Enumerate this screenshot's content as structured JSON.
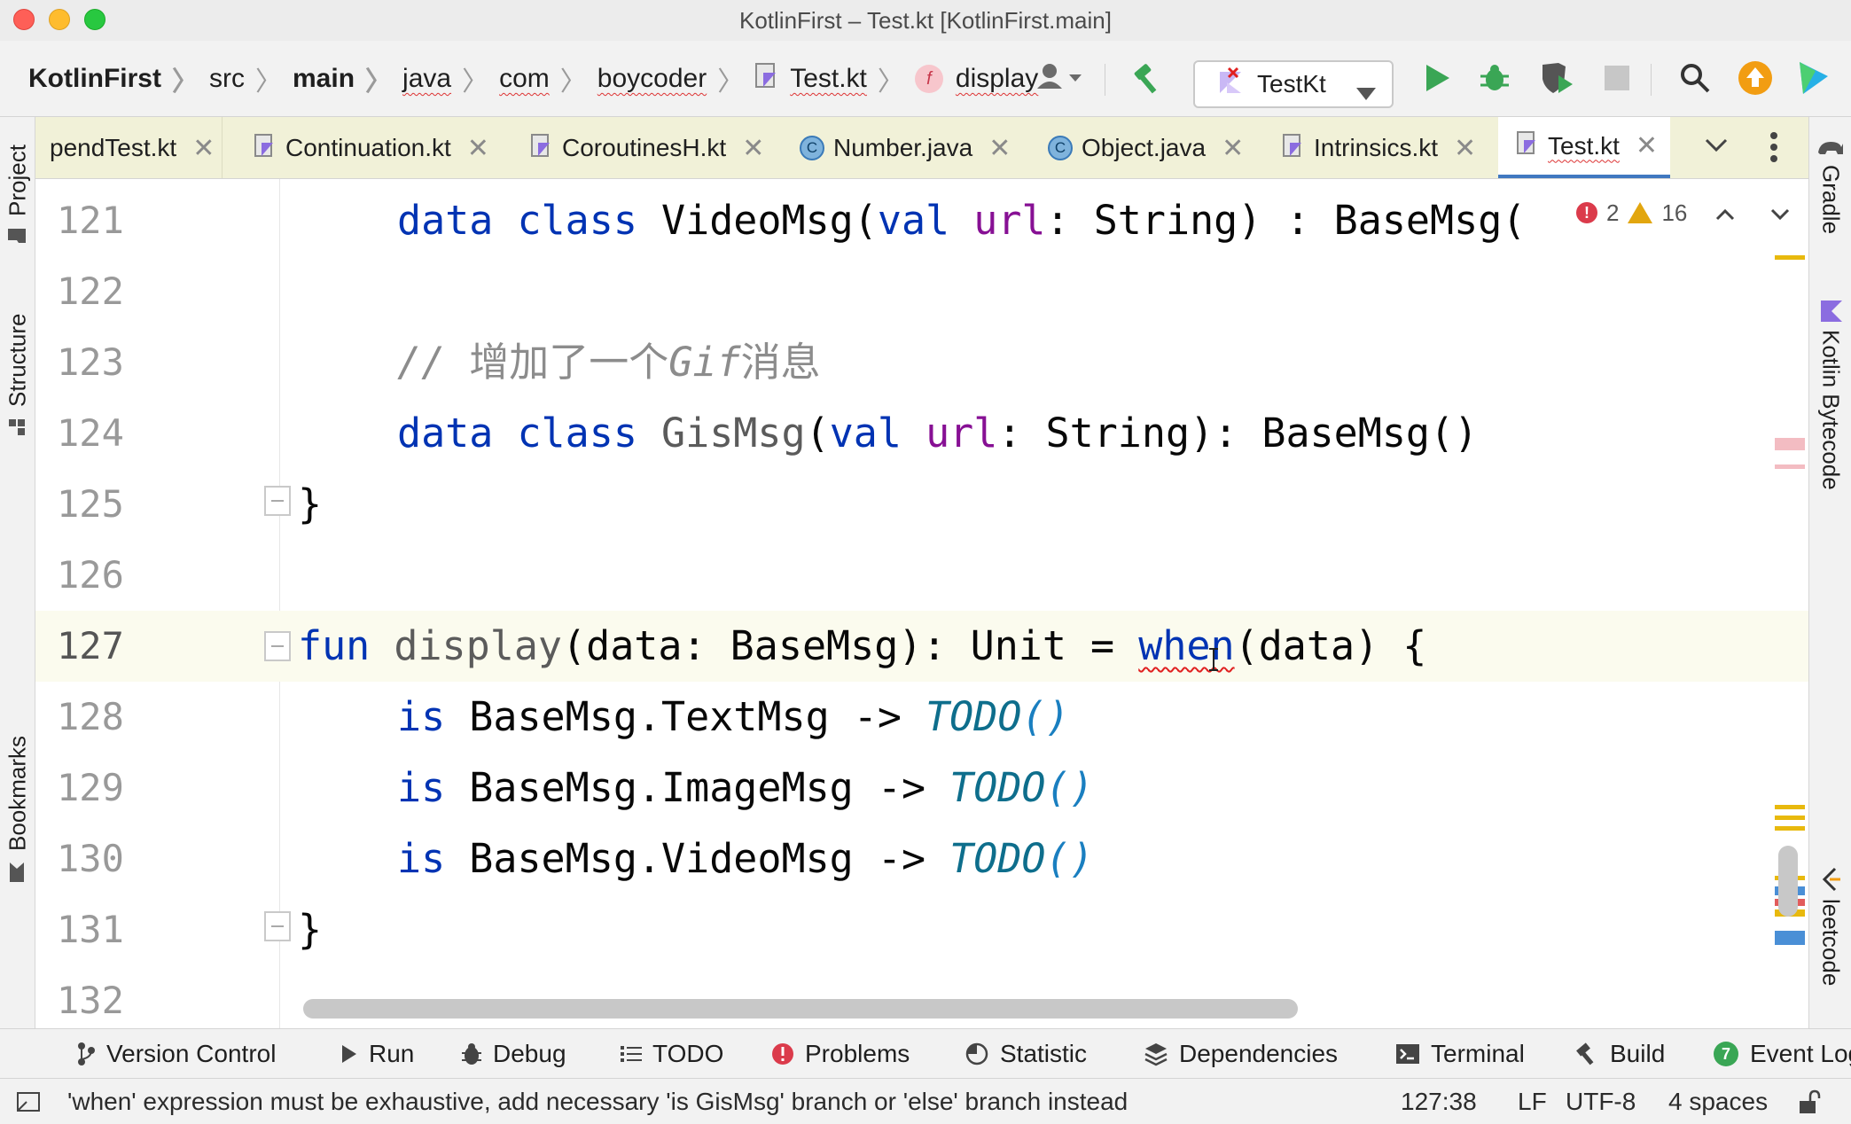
{
  "window": {
    "title": "KotlinFirst – Test.kt [KotlinFirst.main]"
  },
  "breadcrumbs": [
    {
      "label": "KotlinFirst"
    },
    {
      "label": "src"
    },
    {
      "label": "main"
    },
    {
      "label": "java"
    },
    {
      "label": "com"
    },
    {
      "label": "boycoder"
    },
    {
      "label": "Test.kt"
    },
    {
      "label": "display"
    }
  ],
  "toolbar": {
    "run_config": "TestKt"
  },
  "tabs": [
    {
      "label": "pendTest.kt"
    },
    {
      "label": "Continuation.kt"
    },
    {
      "label": "CoroutinesH.kt"
    },
    {
      "label": "Number.java"
    },
    {
      "label": "Object.java"
    },
    {
      "label": "Intrinsics.kt"
    },
    {
      "label": "Test.kt"
    }
  ],
  "left_tools": {
    "project": "Project",
    "structure": "Structure",
    "bookmarks": "Bookmarks"
  },
  "right_tools": {
    "gradle": "Gradle",
    "bytecode": "Kotlin Bytecode",
    "leetcode": "leetcode"
  },
  "inspections": {
    "errors": "2",
    "warnings": "16"
  },
  "editor": {
    "line_numbers": [
      "121",
      "122",
      "123",
      "124",
      "125",
      "126",
      "127",
      "128",
      "129",
      "130",
      "131",
      "132"
    ],
    "current_line": "127",
    "code": {
      "l121": {
        "kw1": "data",
        "kw2": "class",
        "name": "VideoMsg(",
        "kw3": "val",
        "prop": "url",
        "rest": ": String) : BaseMsg("
      },
      "l123": {
        "slashes": "// ",
        "text1": "增加了一个",
        "gif": "Gif",
        "text2": "消息"
      },
      "l124": {
        "kw1": "data",
        "kw2": "class",
        "name": "GisMsg",
        "p1": "(",
        "kw3": "val",
        "prop": "url",
        "rest": ": String): BaseMsg()"
      },
      "l125": "}",
      "l127": {
        "kw": "fun",
        "name": "display",
        "mid": "(data: BaseMsg): Unit = ",
        "when": "when",
        "rest": "(data) {"
      },
      "l128": {
        "kw": "is",
        "type": "BaseMsg.TextMsg -> ",
        "todo": "TODO",
        "paren": "()"
      },
      "l129": {
        "kw": "is",
        "type": "BaseMsg.ImageMsg -> ",
        "todo": "TODO",
        "paren": "()"
      },
      "l130": {
        "kw": "is",
        "type": "BaseMsg.VideoMsg -> ",
        "todo": "TODO",
        "paren": "()"
      },
      "l131": "}"
    }
  },
  "bottom_tools": [
    {
      "label": "Version Control"
    },
    {
      "label": "Run"
    },
    {
      "label": "Debug"
    },
    {
      "label": "TODO"
    },
    {
      "label": "Problems"
    },
    {
      "label": "Statistic"
    },
    {
      "label": "Dependencies"
    },
    {
      "label": "Terminal"
    },
    {
      "label": "Build"
    },
    {
      "label": "Event Log"
    }
  ],
  "status": {
    "message": "'when' expression must be exhaustive, add necessary 'is GisMsg' branch or 'else' branch instead",
    "position": "127:38",
    "line_sep": "LF",
    "encoding": "UTF-8",
    "indent": "4 spaces"
  },
  "colors": {
    "keyword": "#0033b3",
    "property": "#871094",
    "error": "#e02020",
    "tab_active_underline": "#4078c0",
    "run_green": "#3aa655"
  }
}
